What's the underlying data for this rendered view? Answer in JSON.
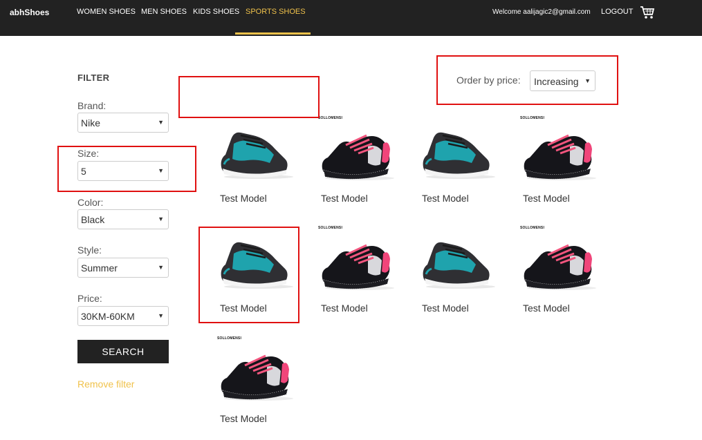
{
  "header": {
    "brand": "abhShoes",
    "nav": [
      {
        "label": "WOMEN SHOES"
      },
      {
        "label": "MEN SHOES"
      },
      {
        "label": "KIDS SHOES"
      },
      {
        "label": "SPORTS SHOES",
        "active": true
      }
    ],
    "welcome": "Welcome aalijagic2@gmail.com",
    "logout": "LOGOUT",
    "cart_icon": "shopping-cart-icon"
  },
  "filter": {
    "title": "FILTER",
    "brand": {
      "label": "Brand:",
      "value": "Nike"
    },
    "size": {
      "label": "Size:",
      "value": "5"
    },
    "color": {
      "label": "Color:",
      "value": "Black"
    },
    "style": {
      "label": "Style:",
      "value": "Summer"
    },
    "price": {
      "label": "Price:",
      "value": "30KM-60KM"
    },
    "search_label": "SEARCH",
    "remove_label": "Remove filter"
  },
  "order": {
    "label": "Order by price:",
    "value": "Increasing"
  },
  "products": [
    {
      "name": "Test Model",
      "variant": "teal"
    },
    {
      "name": "Test Model",
      "variant": "pink",
      "brand_mark": "SOLLOMENSI"
    },
    {
      "name": "Test Model",
      "variant": "teal"
    },
    {
      "name": "Test Model",
      "variant": "pink",
      "brand_mark": "SOLLOMENSI"
    },
    {
      "name": "Test Model",
      "variant": "teal"
    },
    {
      "name": "Test Model",
      "variant": "pink",
      "brand_mark": "SOLLOMENSI"
    },
    {
      "name": "Test Model",
      "variant": "teal"
    },
    {
      "name": "Test Model",
      "variant": "pink",
      "brand_mark": "SOLLOMENSI"
    },
    {
      "name": "Test Model",
      "variant": "pink",
      "brand_mark": "SOLLOMENSI"
    }
  ],
  "colors": {
    "topbar": "#222222",
    "accent": "#f0c24b",
    "annotation": "#e01010"
  }
}
